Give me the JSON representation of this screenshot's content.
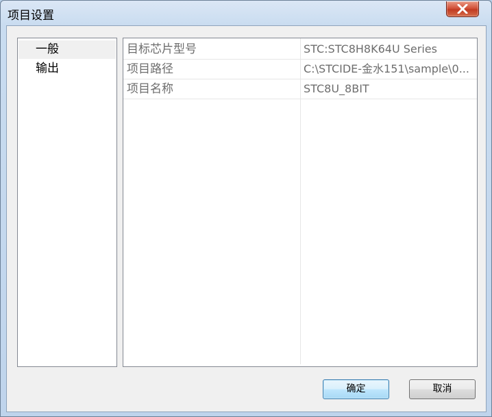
{
  "window": {
    "title": "项目设置"
  },
  "nav": {
    "items": [
      {
        "label": "一般",
        "selected": true
      },
      {
        "label": "输出",
        "selected": false
      }
    ]
  },
  "properties": {
    "rows": [
      {
        "key": "目标芯片型号",
        "value": "STC:STC8H8K64U Series"
      },
      {
        "key": "项目路径",
        "value": "C:\\STCIDE-金水151\\sample\\0..."
      },
      {
        "key": "项目名称",
        "value": "STC8U_8BIT"
      }
    ]
  },
  "buttons": {
    "ok": "确定",
    "cancel": "取消"
  },
  "icons": {
    "close": "close-icon"
  }
}
